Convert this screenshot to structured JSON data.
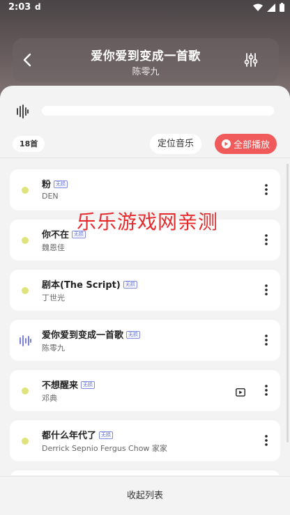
{
  "status_bar": {
    "time": "2:03",
    "notif_icon": "d"
  },
  "player": {
    "title": "爱你爱到变成一首歌",
    "artist": "陈零九"
  },
  "playlist": {
    "count_label": "18首",
    "locate_label": "定位音乐",
    "play_all_label": "全部播放",
    "tag_label": "无损",
    "songs": [
      {
        "title": "粉",
        "artist": "DEN",
        "state": "idle"
      },
      {
        "title": "你不在",
        "artist": "魏恩佳",
        "state": "idle"
      },
      {
        "title": "剧本(The Script)",
        "artist": "丁世光",
        "state": "idle"
      },
      {
        "title": "爱你爱到变成一首歌",
        "artist": "陈零九",
        "state": "playing"
      },
      {
        "title": "不想醒来",
        "artist": "邓典",
        "state": "idle",
        "has_mv": true
      },
      {
        "title": "都什么年代了",
        "artist": "Derrick Sepnio Fergus Chow 家家",
        "state": "idle"
      }
    ],
    "collapse_label": "收起列表"
  },
  "watermark": "乐乐游戏网亲测",
  "colors": {
    "accent": "#f15a5a",
    "dot": "#e0e27a",
    "playing": "#7b80d8"
  }
}
